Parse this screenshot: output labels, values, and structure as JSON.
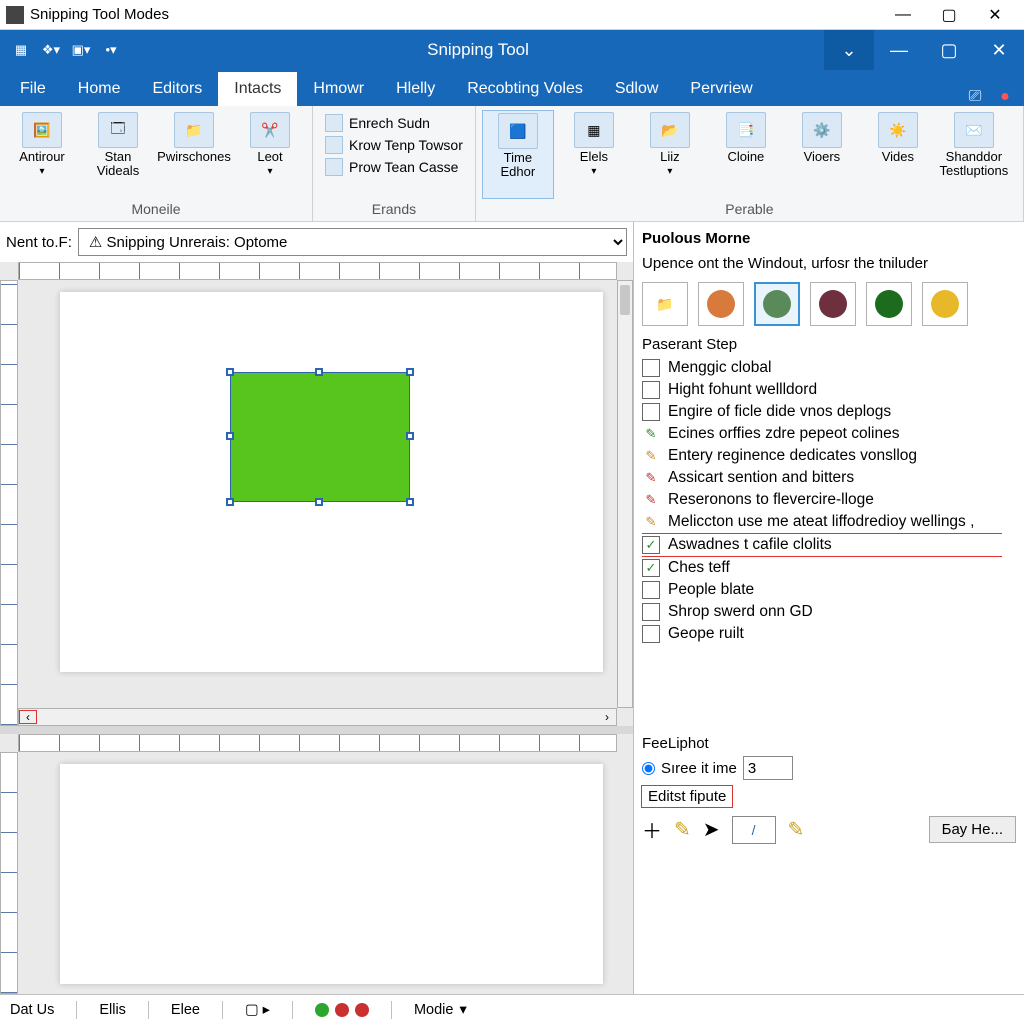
{
  "window": {
    "title": "Snipping Tool Modes"
  },
  "bluebar": {
    "title": "Snipping Tool"
  },
  "tabs": [
    "File",
    "Home",
    "Editors",
    "Intacts",
    "Hmowr",
    "Hlelly",
    "Recobting Voles",
    "Sdlow",
    "Pervriew"
  ],
  "active_tab_index": 3,
  "ribbon": {
    "groups": [
      {
        "label": "Moneile",
        "big": [
          "Antirour",
          "Stan Videals",
          "Pwirschones",
          "Leot"
        ]
      },
      {
        "label": "Erands",
        "small": [
          "Enrech Sudn",
          "Krow Tenp Towsor",
          "Prow Tean Casse"
        ]
      },
      {
        "label": "Perable",
        "big": [
          "Time Edhor",
          "Elels",
          "Liiz",
          "Cloine",
          "Vioers",
          "Vides",
          "Shanddor Testluptions"
        ],
        "selected": 0
      }
    ]
  },
  "nav": {
    "label": "Nent to.F:",
    "selected": "Snipping Unrerais: Optome"
  },
  "right": {
    "header": "Puolous Morne",
    "desc": "Upence ont the Windout, urfosr the tniluder",
    "swatches": [
      {
        "type": "icon",
        "name": "folder"
      },
      {
        "type": "color",
        "hex": "#d77a3b"
      },
      {
        "type": "color",
        "hex": "#5a8a5a",
        "selected": true
      },
      {
        "type": "color",
        "hex": "#6e2f3e"
      },
      {
        "type": "color",
        "hex": "#1d6b1d"
      },
      {
        "type": "color",
        "hex": "#e7b92a"
      }
    ],
    "checklist_header": "Paserant Step",
    "checklist": [
      {
        "text": "Menggic clobal",
        "state": "empty"
      },
      {
        "text": "Hight fohunt wellldord",
        "state": "empty"
      },
      {
        "text": "Engire of ficle dide vnos deplogs",
        "state": "empty"
      },
      {
        "text": "Ecines orffies zdre pepeot colines",
        "state": "pencil-green"
      },
      {
        "text": "Entery reginence dedicates vonsllog",
        "state": "pencil-orange"
      },
      {
        "text": "Assicart sention and bitters",
        "state": "pencil-red"
      },
      {
        "text": "Reseronons to flevercire-lloge",
        "state": "pencil-red"
      },
      {
        "text": "Meliccton use me ateat liffodredioy wellings ,",
        "state": "pencil-orange"
      },
      {
        "text": "Aswadnes t cafile clolits",
        "state": "checked",
        "highlight": true
      },
      {
        "text": "Ches teff",
        "state": "checked"
      },
      {
        "text": "People blate",
        "state": "empty"
      },
      {
        "text": "Shrop swerd onn GD",
        "state": "empty"
      },
      {
        "text": "Geope ruilt",
        "state": "empty"
      }
    ],
    "feel": {
      "header": "FeeLiphot",
      "radio_label": "Sıree it ime",
      "radio_value": "3",
      "edit_label": "Editst fipute",
      "button": "Бау He..."
    }
  },
  "status": {
    "items": [
      "Dat Us",
      "Ellis",
      "Elee"
    ],
    "mode_label": "Modie",
    "dots": [
      "#2ea52e",
      "#c93030",
      "#c93030"
    ]
  },
  "colors": {
    "accent": "#1868b9"
  }
}
